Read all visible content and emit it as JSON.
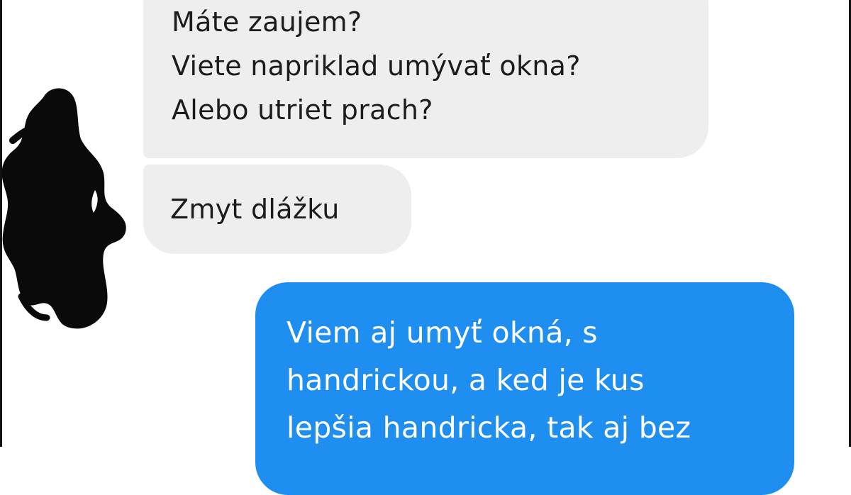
{
  "messages": [
    {
      "direction": "incoming",
      "lines": [
        "Máte zaujem?",
        "Viete napriklad umývať okna?",
        "Alebo utriet prach?"
      ]
    },
    {
      "direction": "incoming",
      "lines": [
        "Zmyt dlážku"
      ]
    },
    {
      "direction": "outgoing",
      "lines": [
        "Viem aj umyť okná, s",
        "handrickou, a ked je kus",
        "lepšia handricka, tak aj bez"
      ]
    }
  ],
  "colors": {
    "incoming_bubble": "#eeeeee",
    "outgoing_bubble": "#1f8ef1",
    "redaction": "#0a0a0a"
  }
}
